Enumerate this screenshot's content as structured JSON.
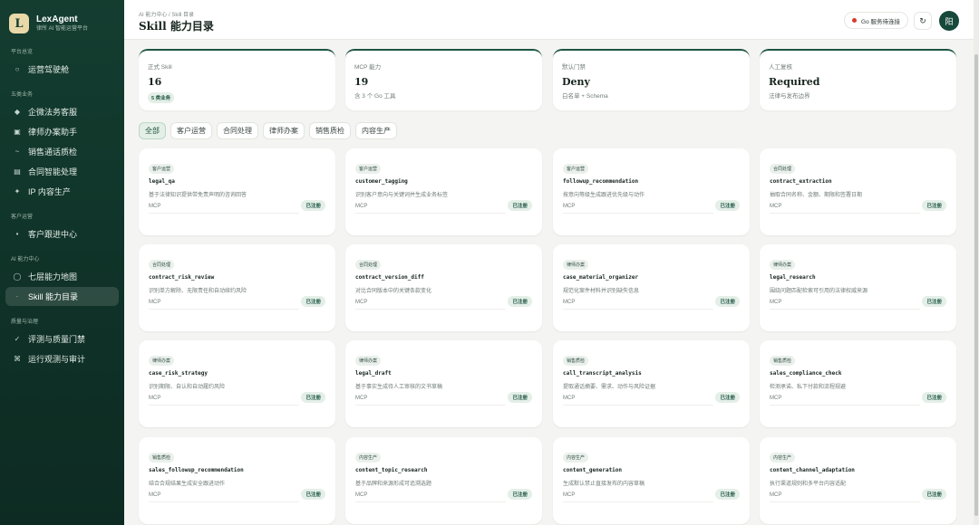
{
  "brand": {
    "logo_letter": "L",
    "name": "LexAgent",
    "subtitle": "律所 AI 智能运营平台"
  },
  "sidebar": {
    "sections": [
      {
        "title": "平台总览",
        "items": [
          {
            "label": "运营驾驶舱",
            "icon": "circle-icon"
          }
        ]
      },
      {
        "title": "五类业务",
        "items": [
          {
            "label": "企微法务客服",
            "icon": "diamond-icon"
          },
          {
            "label": "律师办案助手",
            "icon": "square-icon"
          },
          {
            "label": "销售通话质检",
            "icon": "wave-icon"
          },
          {
            "label": "合同智能处理",
            "icon": "document-icon"
          },
          {
            "label": "IP 内容生产",
            "icon": "sparkle-icon"
          }
        ]
      },
      {
        "title": "客户运营",
        "items": [
          {
            "label": "客户跟进中心",
            "icon": "dot-icon"
          }
        ]
      },
      {
        "title": "AI 能力中心",
        "items": [
          {
            "label": "七层能力地图",
            "icon": "ring-icon"
          },
          {
            "label": "Skill 能力目录",
            "icon": "dot-icon",
            "active": true
          }
        ]
      },
      {
        "title": "质量与治理",
        "items": [
          {
            "label": "评测与质量门禁",
            "icon": "check-icon"
          },
          {
            "label": "运行观测与审计",
            "icon": "command-icon"
          }
        ]
      }
    ]
  },
  "header": {
    "breadcrumb": "AI 能力中心 / Skill 目录",
    "title": "Skill 能力目录",
    "status": "Go 服务待连接",
    "refresh_icon": "↻",
    "avatar": "阳"
  },
  "stats": [
    {
      "label": "正式 Skill",
      "value": "16",
      "badge": "5 类业务"
    },
    {
      "label": "MCP 能力",
      "value": "19",
      "sub": "含 3 个 Go 工具"
    },
    {
      "label": "默认门禁",
      "value": "Deny",
      "sub": "白名单 + Schema"
    },
    {
      "label": "人工复核",
      "value": "Required",
      "sub": "法律与发布边界"
    }
  ],
  "tabs": [
    "全部",
    "客户运营",
    "合同处理",
    "律师办案",
    "销售质检",
    "内容生产"
  ],
  "cards": [
    {
      "tag": "客户运营",
      "name": "legal_qa",
      "desc": "基于法律知识提供带免责声明的咨询回答",
      "type": "MCP",
      "status": "已注册"
    },
    {
      "tag": "客户运营",
      "name": "customer_tagging",
      "desc": "识别客户意向与关键词并生成业务标签",
      "type": "MCP",
      "status": "已注册"
    },
    {
      "tag": "客户运营",
      "name": "followup_recommendation",
      "desc": "按意向等级生成跟进优先级与动作",
      "type": "MCP",
      "status": "已注册"
    },
    {
      "tag": "合同处理",
      "name": "contract_extraction",
      "desc": "抽取合同名称、金额、期限和签署日期",
      "type": "MCP",
      "status": "已注册"
    },
    {
      "tag": "合同处理",
      "name": "contract_risk_review",
      "desc": "识别单方解除、无限责任和自动续约风险",
      "type": "MCP",
      "status": "已注册"
    },
    {
      "tag": "合同处理",
      "name": "contract_version_diff",
      "desc": "对比合同版本中的关键条款变化",
      "type": "MCP",
      "status": "已注册"
    },
    {
      "tag": "律师办案",
      "name": "case_material_organizer",
      "desc": "规范化案件材料并识别缺失信息",
      "type": "MCP",
      "status": "已注册"
    },
    {
      "tag": "律师办案",
      "name": "legal_research",
      "desc": "围绕问题匹配检索可引用的法律权威来源",
      "type": "MCP",
      "status": "已注册"
    },
    {
      "tag": "律师办案",
      "name": "case_risk_strategy",
      "desc": "识别期限、自认和自动履约风险",
      "type": "MCP",
      "status": "已注册"
    },
    {
      "tag": "律师办案",
      "name": "legal_draft",
      "desc": "基于事实生成待人工审核的文书草稿",
      "type": "MCP",
      "status": "已注册"
    },
    {
      "tag": "销售质检",
      "name": "call_transcript_analysis",
      "desc": "提取通话摘要、需求、动作与风险证据",
      "type": "MCP",
      "status": "已注册"
    },
    {
      "tag": "销售质检",
      "name": "sales_compliance_check",
      "desc": "检测承诺、私下付款和流程规避",
      "type": "MCP",
      "status": "已注册"
    },
    {
      "tag": "销售质检",
      "name": "sales_followup_recommendation",
      "desc": "结合合规结果生成安全跟进动作",
      "type": "MCP",
      "status": "已注册"
    },
    {
      "tag": "内容生产",
      "name": "content_topic_research",
      "desc": "基于品牌和来源形成可追溯选题",
      "type": "MCP",
      "status": "已注册"
    },
    {
      "tag": "内容生产",
      "name": "content_generation",
      "desc": "生成默认禁止直接发布的内容草稿",
      "type": "MCP",
      "status": "已注册"
    },
    {
      "tag": "内容生产",
      "name": "content_channel_adaptation",
      "desc": "执行渠道规则和多平台内容适配",
      "type": "MCP",
      "status": "已注册"
    }
  ]
}
